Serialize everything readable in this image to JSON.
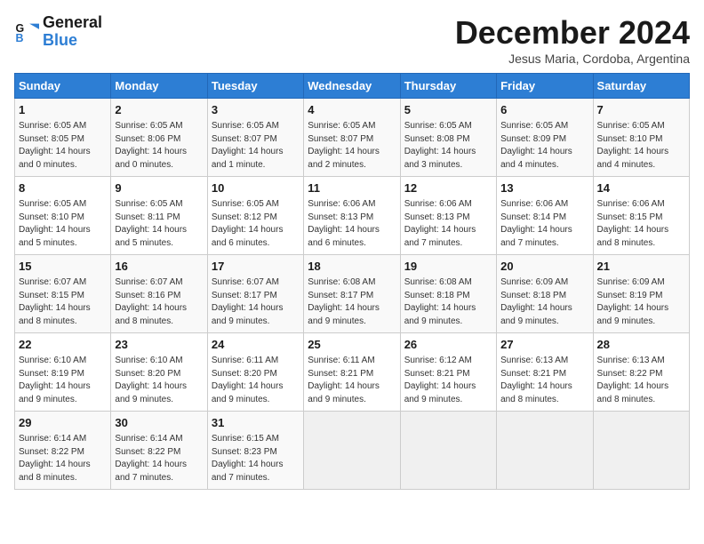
{
  "header": {
    "logo_line1": "General",
    "logo_line2": "Blue",
    "month": "December 2024",
    "location": "Jesus Maria, Cordoba, Argentina"
  },
  "weekdays": [
    "Sunday",
    "Monday",
    "Tuesday",
    "Wednesday",
    "Thursday",
    "Friday",
    "Saturday"
  ],
  "weeks": [
    [
      {
        "day": "1",
        "sunrise": "6:05 AM",
        "sunset": "8:05 PM",
        "daylight": "14 hours and 0 minutes."
      },
      {
        "day": "2",
        "sunrise": "6:05 AM",
        "sunset": "8:06 PM",
        "daylight": "14 hours and 0 minutes."
      },
      {
        "day": "3",
        "sunrise": "6:05 AM",
        "sunset": "8:07 PM",
        "daylight": "14 hours and 1 minute."
      },
      {
        "day": "4",
        "sunrise": "6:05 AM",
        "sunset": "8:07 PM",
        "daylight": "14 hours and 2 minutes."
      },
      {
        "day": "5",
        "sunrise": "6:05 AM",
        "sunset": "8:08 PM",
        "daylight": "14 hours and 3 minutes."
      },
      {
        "day": "6",
        "sunrise": "6:05 AM",
        "sunset": "8:09 PM",
        "daylight": "14 hours and 4 minutes."
      },
      {
        "day": "7",
        "sunrise": "6:05 AM",
        "sunset": "8:10 PM",
        "daylight": "14 hours and 4 minutes."
      }
    ],
    [
      {
        "day": "8",
        "sunrise": "6:05 AM",
        "sunset": "8:10 PM",
        "daylight": "14 hours and 5 minutes."
      },
      {
        "day": "9",
        "sunrise": "6:05 AM",
        "sunset": "8:11 PM",
        "daylight": "14 hours and 5 minutes."
      },
      {
        "day": "10",
        "sunrise": "6:05 AM",
        "sunset": "8:12 PM",
        "daylight": "14 hours and 6 minutes."
      },
      {
        "day": "11",
        "sunrise": "6:06 AM",
        "sunset": "8:13 PM",
        "daylight": "14 hours and 6 minutes."
      },
      {
        "day": "12",
        "sunrise": "6:06 AM",
        "sunset": "8:13 PM",
        "daylight": "14 hours and 7 minutes."
      },
      {
        "day": "13",
        "sunrise": "6:06 AM",
        "sunset": "8:14 PM",
        "daylight": "14 hours and 7 minutes."
      },
      {
        "day": "14",
        "sunrise": "6:06 AM",
        "sunset": "8:15 PM",
        "daylight": "14 hours and 8 minutes."
      }
    ],
    [
      {
        "day": "15",
        "sunrise": "6:07 AM",
        "sunset": "8:15 PM",
        "daylight": "14 hours and 8 minutes."
      },
      {
        "day": "16",
        "sunrise": "6:07 AM",
        "sunset": "8:16 PM",
        "daylight": "14 hours and 8 minutes."
      },
      {
        "day": "17",
        "sunrise": "6:07 AM",
        "sunset": "8:17 PM",
        "daylight": "14 hours and 9 minutes."
      },
      {
        "day": "18",
        "sunrise": "6:08 AM",
        "sunset": "8:17 PM",
        "daylight": "14 hours and 9 minutes."
      },
      {
        "day": "19",
        "sunrise": "6:08 AM",
        "sunset": "8:18 PM",
        "daylight": "14 hours and 9 minutes."
      },
      {
        "day": "20",
        "sunrise": "6:09 AM",
        "sunset": "8:18 PM",
        "daylight": "14 hours and 9 minutes."
      },
      {
        "day": "21",
        "sunrise": "6:09 AM",
        "sunset": "8:19 PM",
        "daylight": "14 hours and 9 minutes."
      }
    ],
    [
      {
        "day": "22",
        "sunrise": "6:10 AM",
        "sunset": "8:19 PM",
        "daylight": "14 hours and 9 minutes."
      },
      {
        "day": "23",
        "sunrise": "6:10 AM",
        "sunset": "8:20 PM",
        "daylight": "14 hours and 9 minutes."
      },
      {
        "day": "24",
        "sunrise": "6:11 AM",
        "sunset": "8:20 PM",
        "daylight": "14 hours and 9 minutes."
      },
      {
        "day": "25",
        "sunrise": "6:11 AM",
        "sunset": "8:21 PM",
        "daylight": "14 hours and 9 minutes."
      },
      {
        "day": "26",
        "sunrise": "6:12 AM",
        "sunset": "8:21 PM",
        "daylight": "14 hours and 9 minutes."
      },
      {
        "day": "27",
        "sunrise": "6:13 AM",
        "sunset": "8:21 PM",
        "daylight": "14 hours and 8 minutes."
      },
      {
        "day": "28",
        "sunrise": "6:13 AM",
        "sunset": "8:22 PM",
        "daylight": "14 hours and 8 minutes."
      }
    ],
    [
      {
        "day": "29",
        "sunrise": "6:14 AM",
        "sunset": "8:22 PM",
        "daylight": "14 hours and 8 minutes."
      },
      {
        "day": "30",
        "sunrise": "6:14 AM",
        "sunset": "8:22 PM",
        "daylight": "14 hours and 7 minutes."
      },
      {
        "day": "31",
        "sunrise": "6:15 AM",
        "sunset": "8:23 PM",
        "daylight": "14 hours and 7 minutes."
      },
      null,
      null,
      null,
      null
    ]
  ]
}
